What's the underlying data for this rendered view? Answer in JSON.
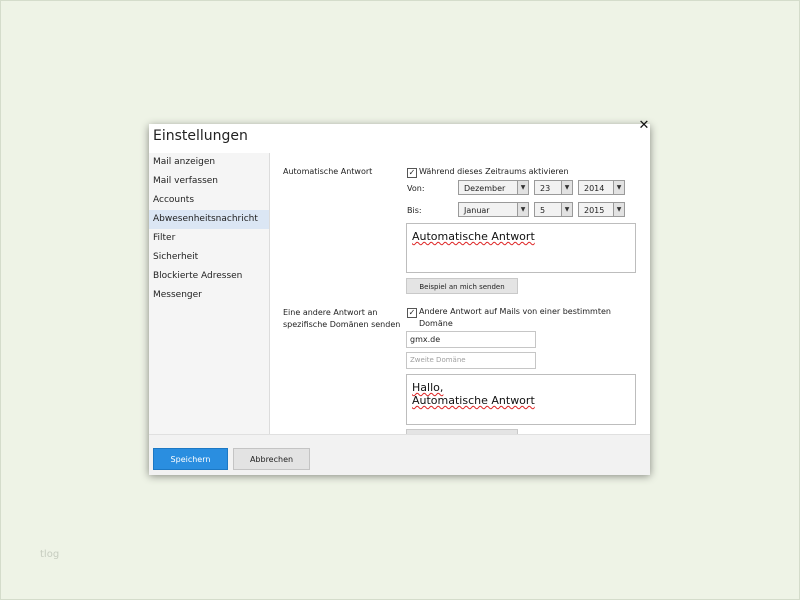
{
  "watermark": "tlog",
  "dialog": {
    "title": "Einstellungen",
    "close_glyph": "✕"
  },
  "sidebar": {
    "items": [
      {
        "label": "Mail anzeigen",
        "active": false
      },
      {
        "label": "Mail verfassen",
        "active": false
      },
      {
        "label": "Accounts",
        "active": false
      },
      {
        "label": "Abwesenheitsnachricht",
        "active": true
      },
      {
        "label": "Filter",
        "active": false
      },
      {
        "label": "Sicherheit",
        "active": false
      },
      {
        "label": "Blockierte Adressen",
        "active": false
      },
      {
        "label": "Messenger",
        "active": false
      }
    ]
  },
  "auto_reply": {
    "section_label": "Automatische Antwort",
    "enable_checked": true,
    "enable_label": "Während dieses Zeitraums aktivieren",
    "from_label": "Von:",
    "from_month": "Dezember",
    "from_day": "23",
    "from_year": "2014",
    "to_label": "Bis:",
    "to_month": "Januar",
    "to_day": "5",
    "to_year": "2015",
    "message": "Automatische Antwort",
    "send_example_label": "Beispiel an mich senden"
  },
  "domain_reply": {
    "section_label_line1": "Eine andere Antwort an",
    "section_label_line2": "spezifische Domänen senden",
    "enable_checked": true,
    "enable_label_line1": "Andere Antwort auf Mails von einer bestimmten",
    "enable_label_line2": "Domäne",
    "domain1_value": "gmx.de",
    "domain2_placeholder": "Zweite Domäne",
    "message_line1": "Hallo,",
    "message_line2": "Automatische Antwort"
  },
  "footer": {
    "save_label": "Speichern",
    "cancel_label": "Abbrechen"
  },
  "colors": {
    "background": "#eef3e6",
    "primary_button": "#2a8ee0",
    "active_sidebar": "#dbe6f4"
  },
  "icons": {
    "close": "close-icon",
    "dropdown": "chevron-down-icon",
    "checkbox": "checkmark-icon"
  }
}
